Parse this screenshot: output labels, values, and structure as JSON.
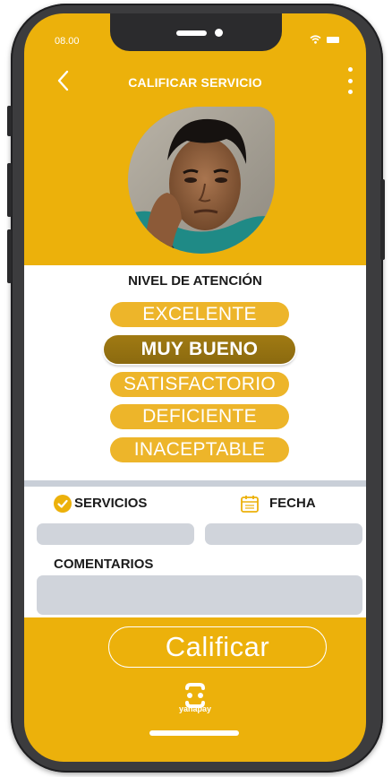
{
  "status_bar": {
    "time": "08.00"
  },
  "header": {
    "title": "CALIFICAR SERVICIO"
  },
  "rating": {
    "title": "NIVEL DE ATENCIÓN",
    "options": [
      "EXCELENTE",
      "MUY BUENO",
      "SATISFACTORIO",
      "DEFICIENTE",
      "INACEPTABLE"
    ],
    "selected": "MUY BUENO"
  },
  "form": {
    "servicios_label": "SERVICIOS",
    "fecha_label": "FECHA",
    "comentarios_label": "COMENTARIOS",
    "servicios_value": "",
    "fecha_value": "",
    "comentarios_value": ""
  },
  "actions": {
    "submit_label": "Calificar"
  },
  "brand": {
    "name": "yanapay"
  },
  "colors": {
    "accent": "#ecb10b",
    "selected": "#8b6a10",
    "field": "#d0d4db"
  }
}
